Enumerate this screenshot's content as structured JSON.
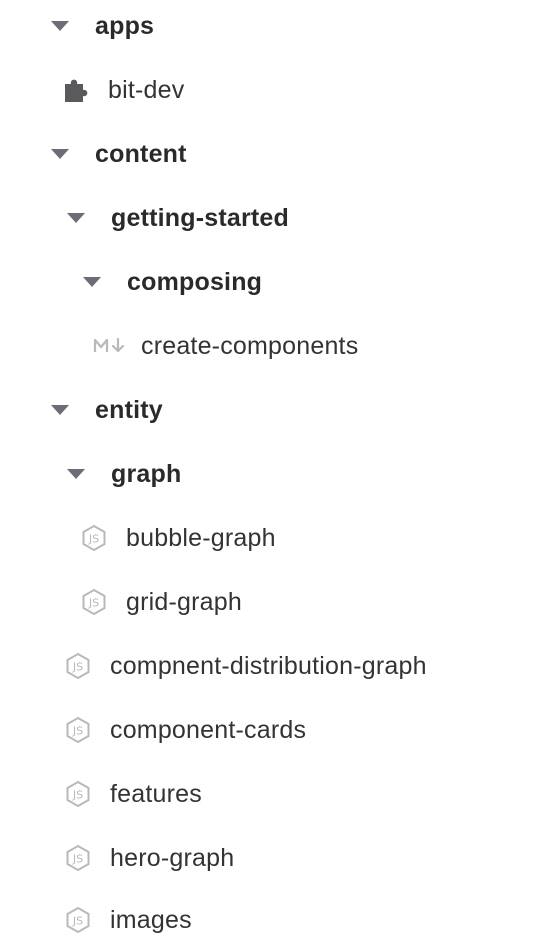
{
  "tree": {
    "apps": {
      "label": "apps"
    },
    "bit_dev": {
      "label": "bit-dev"
    },
    "content": {
      "label": "content"
    },
    "getting_started": {
      "label": "getting-started"
    },
    "composing": {
      "label": "composing"
    },
    "create_components": {
      "label": "create-components"
    },
    "entity": {
      "label": "entity"
    },
    "graph": {
      "label": "graph"
    },
    "bubble_graph": {
      "label": "bubble-graph"
    },
    "grid_graph": {
      "label": "grid-graph"
    },
    "compnent_distribution_graph": {
      "label": "compnent-distribution-graph"
    },
    "component_cards": {
      "label": "component-cards"
    },
    "features": {
      "label": "features"
    },
    "hero_graph": {
      "label": "hero-graph"
    },
    "images": {
      "label": "images"
    }
  },
  "icons": {
    "chevron": "chevron-down-icon",
    "app": "puzzle-piece-icon",
    "markdown": "markdown-icon",
    "js": "js-hexagon-icon"
  },
  "colors": {
    "chevron": "#6b6d76",
    "icon_gray": "#b9b9bd",
    "puzzle": "#5a5a5e",
    "text": "#2b2b2b"
  }
}
